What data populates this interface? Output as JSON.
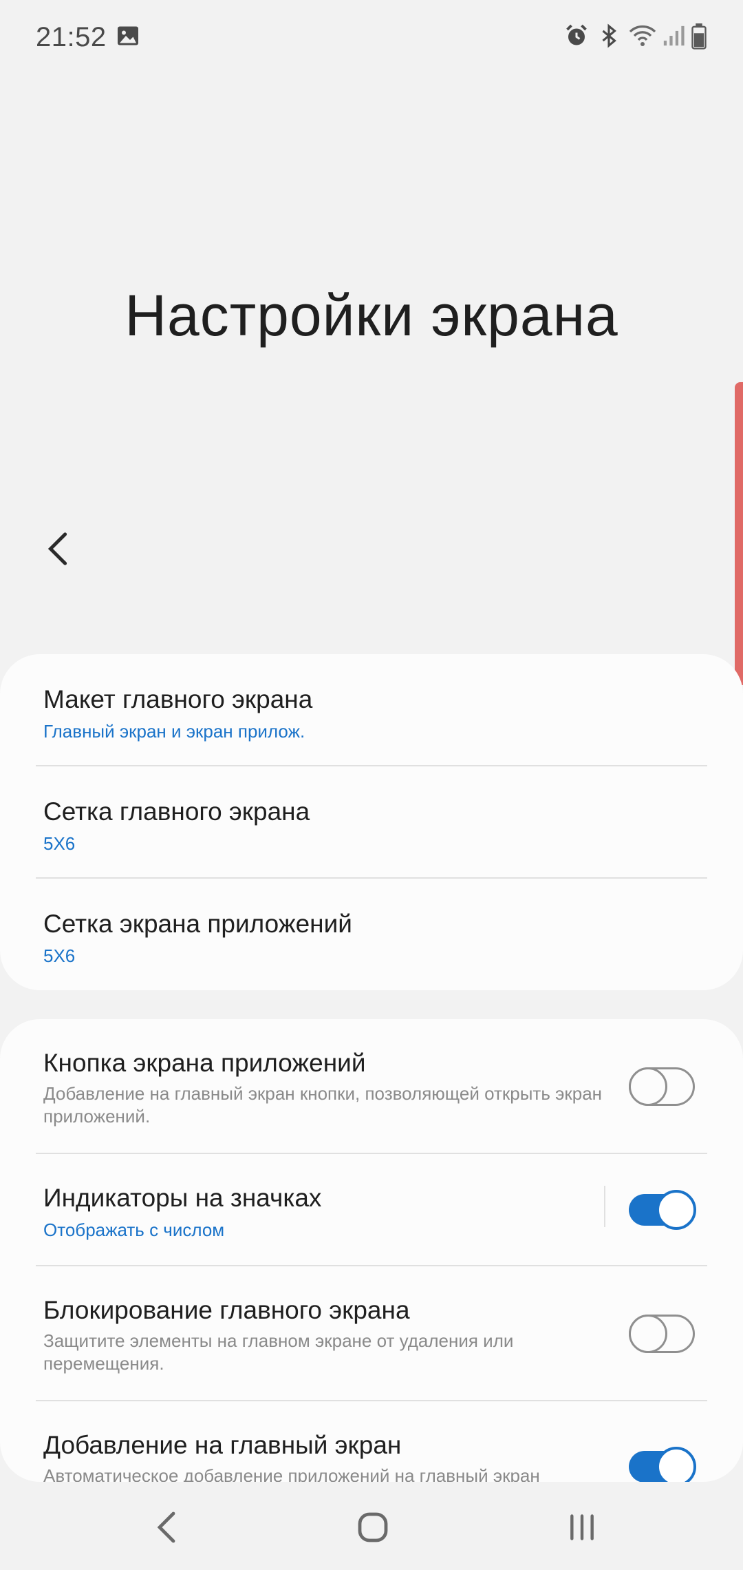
{
  "status_bar": {
    "time": "21:52",
    "icons": [
      "image-icon",
      "alarm-icon",
      "bluetooth-icon",
      "wifi-icon",
      "signal-icon",
      "battery-icon"
    ]
  },
  "header": {
    "title": "Настройки экрана"
  },
  "section1": {
    "items": [
      {
        "title": "Макет главного экрана",
        "subtitle": "Главный экран и экран прилож."
      },
      {
        "title": "Сетка главного экрана",
        "subtitle": "5X6"
      },
      {
        "title": "Сетка экрана приложений",
        "subtitle": "5X6"
      }
    ]
  },
  "section2": {
    "items": [
      {
        "title": "Кнопка экрана приложений",
        "description": "Добавление на главный экран кнопки, позволяющей открыть экран приложений.",
        "toggle": false
      },
      {
        "title": "Индикаторы на значках",
        "subtitle": "Отображать с числом",
        "toggle": true
      },
      {
        "title": "Блокирование главного экрана",
        "description": "Защитите элементы на главном экране от удаления или перемещения.",
        "toggle": false
      },
      {
        "title": "Добавление на главный экран",
        "description": "Автоматическое добавление приложений на главный экран",
        "toggle": true
      }
    ]
  },
  "colors": {
    "accent": "#1a73c9",
    "background": "#f2f2f2",
    "card": "#fcfcfc",
    "scroll_indicator": "#e06a66"
  }
}
